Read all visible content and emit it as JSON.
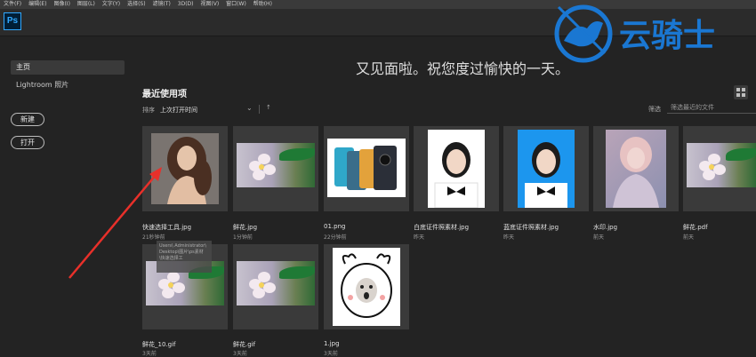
{
  "menu": [
    "文件(F)",
    "编辑(E)",
    "图像(I)",
    "图层(L)",
    "文字(Y)",
    "选择(S)",
    "滤镜(T)",
    "3D(D)",
    "视图(V)",
    "窗口(W)",
    "帮助(H)"
  ],
  "app_logo": "Ps",
  "sidebar": {
    "home": "主页",
    "lightroom": "Lightroom 照片",
    "new_button": "新建",
    "open_button": "打开"
  },
  "greeting": "又见面啦。祝您度过愉快的一天。",
  "recent": {
    "title": "最近使用项",
    "sort_label": "排序",
    "sort_value": "上次打开时间",
    "filter_label": "筛选",
    "filter_placeholder": "筛选最近的文件"
  },
  "files": [
    {
      "name": "快速选择工具.jpg",
      "time": "21秒钟前",
      "thumb": "woman"
    },
    {
      "name": "鲜花.jpg",
      "time": "1分钟前",
      "thumb": "flower"
    },
    {
      "name": "01.png",
      "time": "22分钟前",
      "thumb": "phones"
    },
    {
      "name": "白底证件照素材.jpg",
      "time": "昨天",
      "thumb": "id-white"
    },
    {
      "name": "蓝底证件照素材.jpg",
      "time": "昨天",
      "thumb": "id-blue"
    },
    {
      "name": "水印.jpg",
      "time": "前天",
      "thumb": "watermark"
    },
    {
      "name": "鲜花.pdf",
      "time": "前天",
      "thumb": "flower"
    },
    {
      "name": "鲜花_10.gif",
      "time": "3天前",
      "thumb": "flower"
    },
    {
      "name": "鲜花.gif",
      "time": "3天前",
      "thumb": "flower"
    },
    {
      "name": "1.jpg",
      "time": "3天前",
      "thumb": "meme"
    }
  ],
  "tooltip": "Users\\ Administrator\\ Desktop\\图片\\ps素材\\快速选择工",
  "watermark_brand": "云骑士",
  "colors": {
    "accent": "#31a8ff",
    "arrow": "#e8302a",
    "brand_blue": "#1a77d2"
  }
}
